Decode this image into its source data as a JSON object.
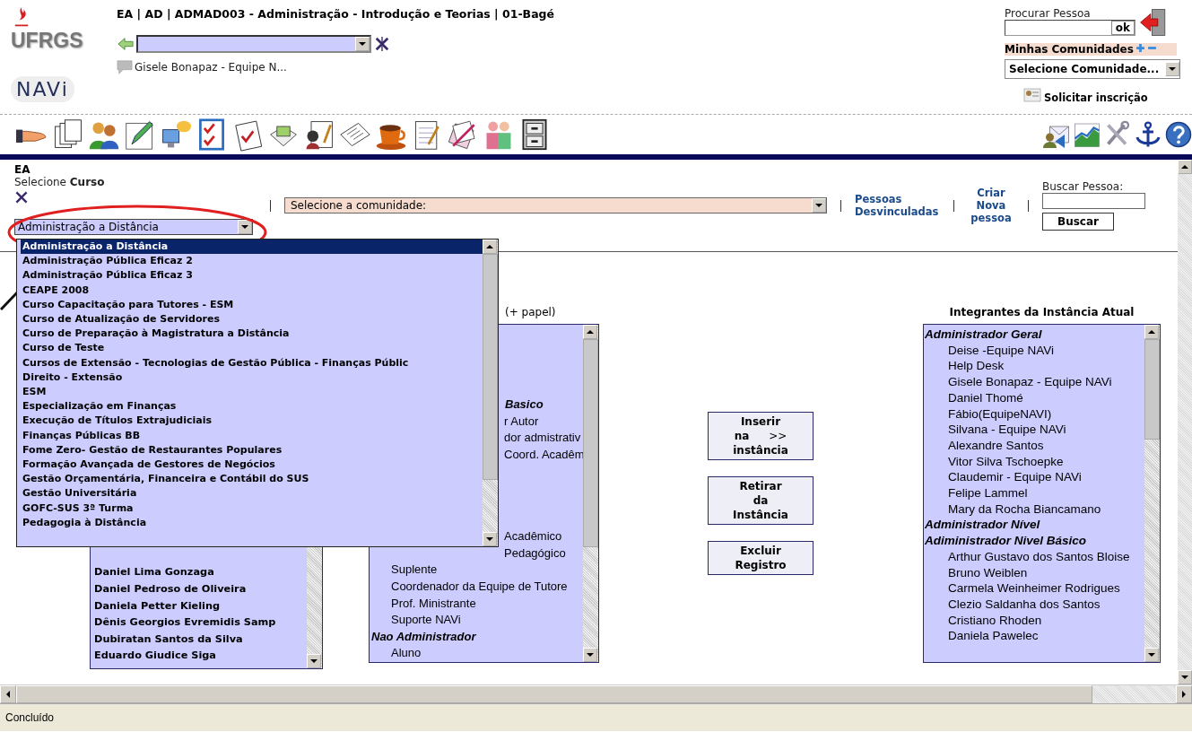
{
  "header": {
    "logo_text": "UFRGS",
    "app_logo_text": "NAVi",
    "title": "EA | AD | ADMAD003 - Administração - Introdução e Teorias | 01-Bagé",
    "user_name": "Gisele Bonapaz - Equipe N..."
  },
  "person_search": {
    "label": "Procurar Pessoa",
    "button": "ok"
  },
  "communities": {
    "label": "Minhas Comunidades",
    "select": "Selecione Comunidade...",
    "request_link": "Solicitar inscrição"
  },
  "form": {
    "section": "EA",
    "course_label": "Selecione **Curso**",
    "course_select": "Administração a Distância",
    "community_select": "Selecione a comunidade:",
    "unlinked_link": "Pessoas Desvinculadas",
    "create_link": "Criar Nova pessoa",
    "search_label": "Buscar Pessoa:",
    "search_button": "Buscar"
  },
  "course_dropdown": {
    "options": [
      {
        "label": "Administração a Distância",
        "selected": true
      },
      {
        "label": "Administração Pública Eficaz 2",
        "selected": false
      },
      {
        "label": "Administração Pública Eficaz 3",
        "selected": false
      },
      {
        "label": "CEAPE 2008",
        "selected": false
      },
      {
        "label": "Curso Capacitação para Tutores - ESM",
        "selected": false
      },
      {
        "label": "Curso de Atualização de Servidores",
        "selected": false
      },
      {
        "label": "Curso de Preparação à Magistratura a Distância",
        "selected": false
      },
      {
        "label": "Curso de Teste",
        "selected": false
      },
      {
        "label": "Cursos de Extensão - Tecnologias de Gestão Pública - Finanças Públic",
        "selected": false
      },
      {
        "label": "Direito - Extensão",
        "selected": false
      },
      {
        "label": "ESM",
        "selected": false
      },
      {
        "label": "Especialização em Finanças",
        "selected": false
      },
      {
        "label": "Execução de Títulos Extrajudiciais",
        "selected": false
      },
      {
        "label": "Finanças Públicas BB",
        "selected": false
      },
      {
        "label": "Fome Zero- Gestão de Restaurantes Populares",
        "selected": false
      },
      {
        "label": "Formação Avançada de Gestores de Negócios",
        "selected": false
      },
      {
        "label": "Gestão Orçamentária, Financeira e Contábil do SUS",
        "selected": false
      },
      {
        "label": "Gestão Universitária",
        "selected": false
      },
      {
        "label": "GOFC-SUS 3ª Turma",
        "selected": false
      },
      {
        "label": "Pedagogia à Distância",
        "selected": false
      }
    ]
  },
  "people_list": {
    "items": [
      "Daniel Lima Gonzaga",
      "Daniel Pedroso de Oliveira",
      "Daniela Petter Kieling",
      "Dênis Georgios Evremidis Samp",
      "Dubiratan Santos da Silva",
      "Eduardo Giudice Siga"
    ]
  },
  "roles_list": {
    "heading": "(+ papel)",
    "items": [
      {
        "kind": "clipped-group",
        "text": "Basico"
      },
      {
        "kind": "clipped-member",
        "text": "r Autor"
      },
      {
        "kind": "clipped-member",
        "text": "dor admistrativ"
      },
      {
        "kind": "clipped-member",
        "text": "Coord. Acadêm"
      },
      {
        "kind": "clipped-member",
        "text": "Acadêmico"
      },
      {
        "kind": "clipped-member",
        "text": "Pedagógico"
      },
      {
        "kind": "member",
        "text": "Suplente"
      },
      {
        "kind": "member",
        "text": "Coordenador da Equipe de Tutore"
      },
      {
        "kind": "member",
        "text": "Prof. Ministrante"
      },
      {
        "kind": "member",
        "text": "Suporte NAVi"
      },
      {
        "kind": "group",
        "text": "Nao Administrador"
      },
      {
        "kind": "member",
        "text": "Aluno"
      }
    ]
  },
  "actions": [
    {
      "lines": [
        "Inserir",
        "na",
        "instância"
      ],
      "arrow": ">>"
    },
    {
      "lines": [
        "Retirar",
        "da",
        "Instância"
      ]
    },
    {
      "lines": [
        "Excluir",
        "Registro"
      ]
    }
  ],
  "members": {
    "heading": "Integrantes da Instância Atual",
    "items": [
      {
        "kind": "group",
        "text": "Administrador Geral"
      },
      {
        "kind": "member",
        "text": "Deise -Equipe NAVi"
      },
      {
        "kind": "member",
        "text": "Help Desk"
      },
      {
        "kind": "member",
        "text": "Gisele Bonapaz - Equipe NAVi"
      },
      {
        "kind": "member",
        "text": "Daniel Thomé"
      },
      {
        "kind": "member",
        "text": "Fábio(EquipeNAVI)"
      },
      {
        "kind": "member",
        "text": "Silvana - Equipe NAVi"
      },
      {
        "kind": "member",
        "text": "Alexandre Santos"
      },
      {
        "kind": "member",
        "text": "Vitor Silva Tschoepke"
      },
      {
        "kind": "member",
        "text": "Claudemir - Equipe NAVi"
      },
      {
        "kind": "member",
        "text": "Felipe Lammel"
      },
      {
        "kind": "member",
        "text": "Mary da Rocha Biancamano"
      },
      {
        "kind": "group",
        "text": "Administrador Nível"
      },
      {
        "kind": "group",
        "text": "Adiministrador Nivel Básico"
      },
      {
        "kind": "member",
        "text": "Arthur Gustavo dos Santos Bloise"
      },
      {
        "kind": "member",
        "text": "Bruno Weiblen"
      },
      {
        "kind": "member",
        "text": "Carmela Weinheimer Rodrigues"
      },
      {
        "kind": "member",
        "text": "Clezio Saldanha dos Santos"
      },
      {
        "kind": "member",
        "text": "Cristiano Rhoden"
      },
      {
        "kind": "member",
        "text": "Daniela Pawelec"
      }
    ]
  },
  "status_bar": "Concluído"
}
